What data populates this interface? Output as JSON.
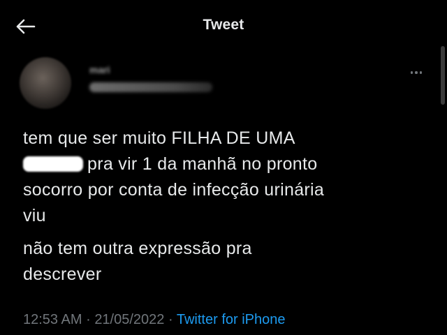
{
  "header": {
    "title": "Tweet"
  },
  "author": {
    "name": "mari"
  },
  "tweet": {
    "line1": "tem que ser muito FILHA DE UMA",
    "line2_after_redaction": "pra vir 1 da manhã no pronto",
    "line3": "socorro por conta de infecção urinária",
    "line4": "viu",
    "paragraph2_line1": "não tem outra expressão pra",
    "paragraph2_line2": "descrever"
  },
  "meta": {
    "time": "12:53 AM",
    "separator1": "·",
    "date": "21/05/2022",
    "separator2": "·",
    "source": "Twitter for iPhone"
  },
  "colors": {
    "background": "#000000",
    "text_primary": "#e7e9ea",
    "text_secondary": "#71767b",
    "accent": "#1d9bf0"
  },
  "icons": {
    "back": "arrow-left-icon",
    "more": "more-horizontal-icon"
  }
}
